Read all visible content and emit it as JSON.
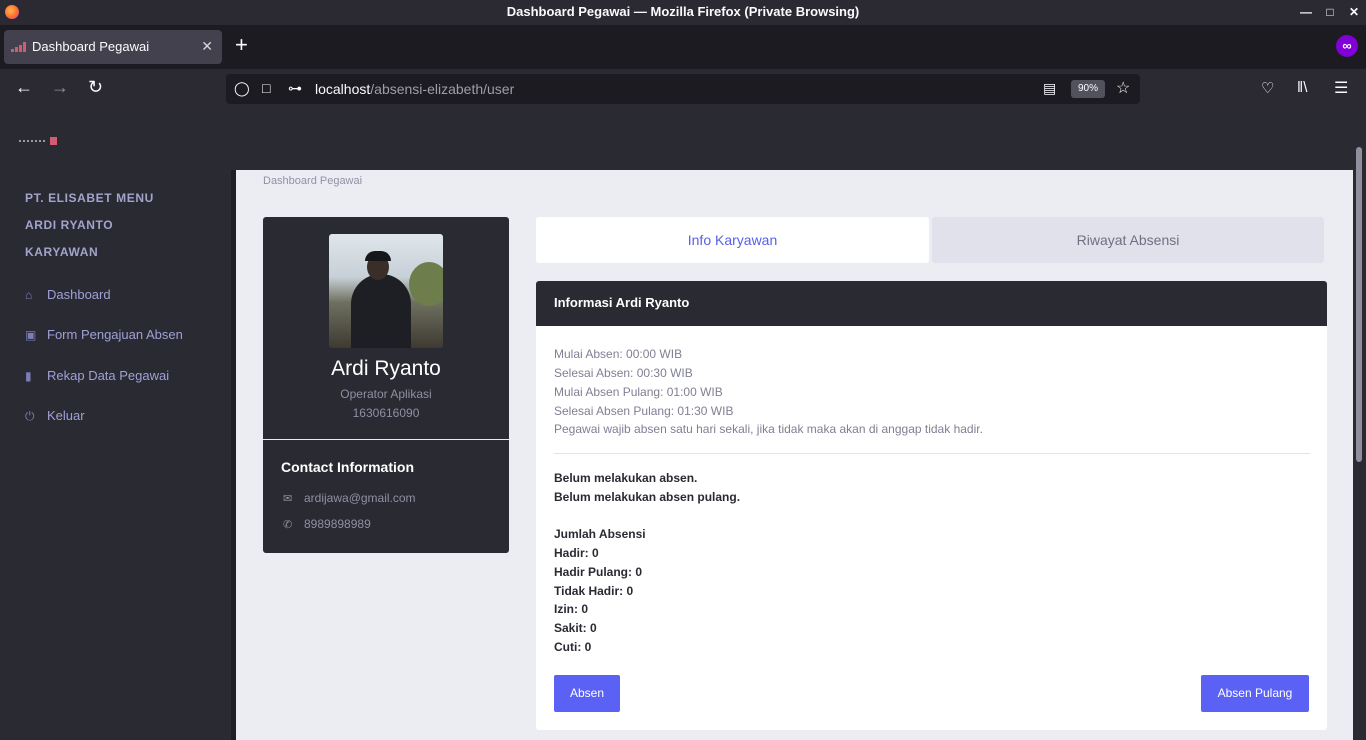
{
  "window": {
    "title": "Dashboard Pegawai — Mozilla Firefox (Private Browsing)"
  },
  "browser": {
    "tab_title": "Dashboard Pegawai",
    "url_host": "localhost",
    "url_path": "/absensi-elizabeth/user",
    "zoom": "90%"
  },
  "sidebar": {
    "headings": [
      "PT. ELISABET MENU",
      "ARDI RYANTO",
      "KARYAWAN"
    ],
    "items": [
      {
        "label": "Dashboard",
        "icon": "home-icon"
      },
      {
        "label": "Form Pengajuan Absen",
        "icon": "book-icon"
      },
      {
        "label": "Rekap Data Pegawai",
        "icon": "file-icon"
      },
      {
        "label": "Keluar",
        "icon": "power-icon"
      }
    ]
  },
  "breadcrumb": "Dashboard Pegawai",
  "profile": {
    "name": "Ardi Ryanto",
    "role": "Operator Aplikasi",
    "nip": "1630616090",
    "contact_title": "Contact Information",
    "email": "ardijawa@gmail.com",
    "phone": "8989898989"
  },
  "tabs": {
    "info": "Info Karyawan",
    "riwayat": "Riwayat Absensi"
  },
  "info": {
    "title": "Informasi Ardi Ryanto",
    "lines": [
      "Mulai Absen: 00:00 WIB",
      "Selesai Absen: 00:30 WIB",
      "Mulai Absen Pulang: 01:00 WIB",
      "Selesai Absen Pulang: 01:30 WIB",
      "Pegawai wajib absen satu hari sekali, jika tidak maka akan di anggap tidak hadir."
    ],
    "status": [
      "Belum melakukan absen.",
      "Belum melakukan absen pulang."
    ],
    "summary_title": "Jumlah Absensi",
    "summary": [
      "Hadir: 0",
      "Hadir Pulang: 0",
      "Tidak Hadir: 0",
      "Izin: 0",
      "Sakit: 0",
      "Cuti: 0"
    ],
    "btn_absen": "Absen",
    "btn_pulang": "Absen Pulang"
  },
  "colors": {
    "accent": "#5b61f5",
    "dark": "#2a2a33",
    "tab_active_text": "#5661e6"
  }
}
